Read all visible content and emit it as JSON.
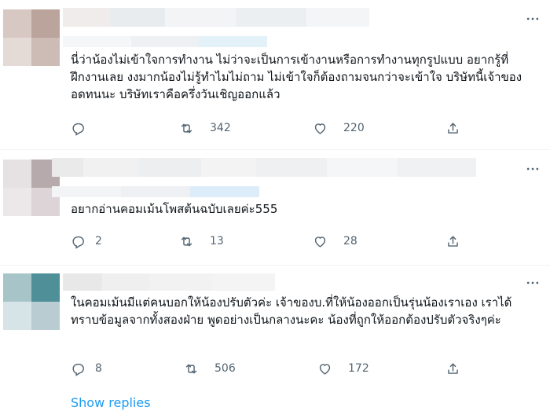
{
  "tweets": [
    {
      "text": "นี่ว่าน้องไม่เข้าใจการทำงาน ไม่ว่าจะเป็นการเข้างานหรือการทำงานทุกรูปแบบ อยากรู้ที่ฝึกงานเลย งงมากน้องไม่รู้ทำไมไม่ถาม ไม่เข้าใจก็ต้องถามจนกว่าจะเข้าใจ บริษัทนี้เจ้าของอดทนนะ บริษัทเราคือครึ่งวันเชิญออกแล้ว",
      "replies": "",
      "retweets": "342",
      "likes": "220"
    },
    {
      "text": "อยากอ่านคอมเม้นโพสต้นฉบับเลยค่ะ555",
      "replies": "2",
      "retweets": "13",
      "likes": "28"
    },
    {
      "text": "ในคอมเม้นมีแต่คนบอกให้น้องปรับตัวค่ะ เจ้าของบ.ที่ให้น้องออกเป็นรุ่นน้องเราเอง เราได้ทราบข้อมูลจากทั้งสองฝ่าย พูดอย่างเป็นกลางนะคะ น้องที่ถูกให้ออกต้องปรับตัวจริงๆค่ะ",
      "replies": "8",
      "retweets": "506",
      "likes": "172"
    }
  ],
  "show_replies_label": "Show replies",
  "icons": {
    "reply": "reply-icon",
    "retweet": "retweet-icon",
    "like": "heart-icon",
    "share": "share-icon",
    "more": "more-icon"
  },
  "colors": {
    "text": "#0f1419",
    "muted": "#536471",
    "link": "#1d9bf0",
    "divider": "#eff3f4"
  }
}
